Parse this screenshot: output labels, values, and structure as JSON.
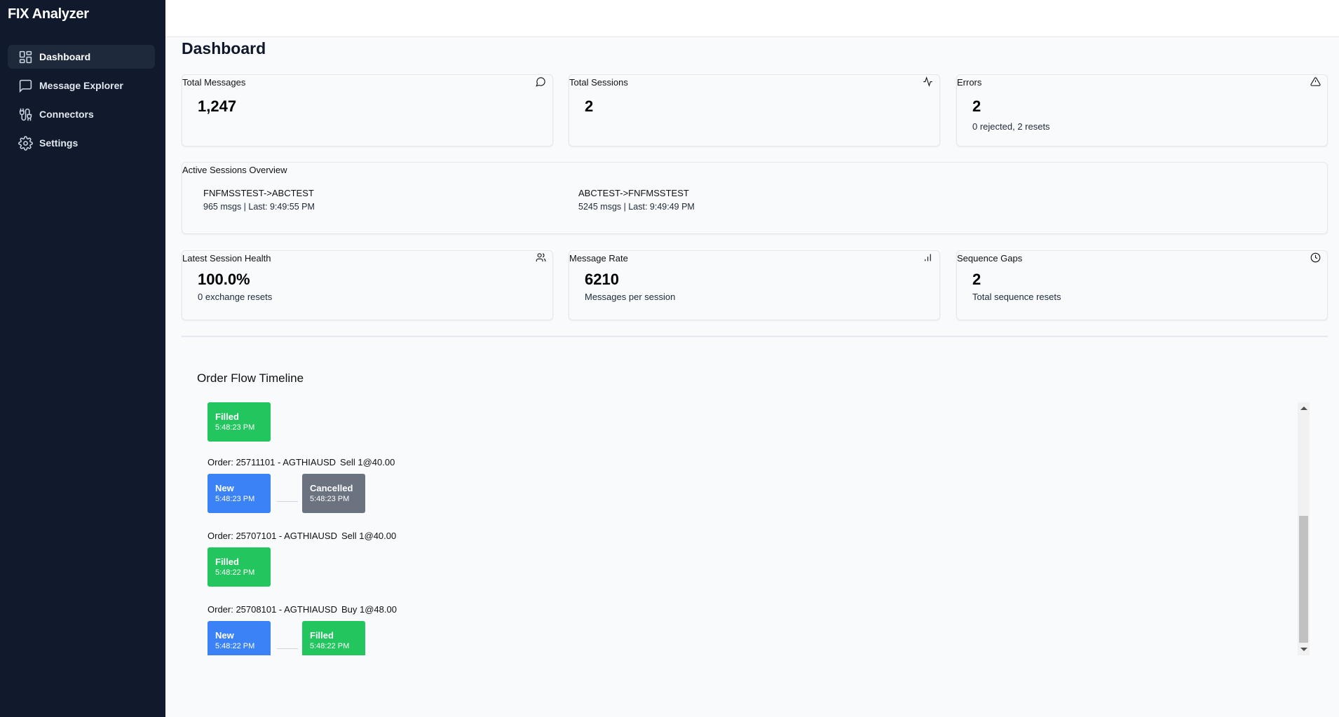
{
  "app": {
    "title": "FIX Analyzer"
  },
  "sidebar": {
    "items": [
      {
        "label": "Dashboard",
        "icon": "dashboard-icon",
        "active": true
      },
      {
        "label": "Message Explorer",
        "icon": "message-square-icon",
        "active": false
      },
      {
        "label": "Connectors",
        "icon": "plug-icon",
        "active": false
      },
      {
        "label": "Settings",
        "icon": "gear-icon",
        "active": false
      }
    ]
  },
  "page": {
    "title": "Dashboard"
  },
  "stats": {
    "total_messages": {
      "title": "Total Messages",
      "value": "1,247",
      "icon": "message-circle-icon"
    },
    "total_sessions": {
      "title": "Total Sessions",
      "value": "2",
      "icon": "activity-icon"
    },
    "errors": {
      "title": "Errors",
      "value": "2",
      "sub": "0 rejected, 2 resets",
      "icon": "alert-triangle-icon"
    },
    "session_health": {
      "title": "Latest Session Health",
      "value": "100.0%",
      "sub": "0 exchange resets",
      "icon": "users-icon"
    },
    "message_rate": {
      "title": "Message Rate",
      "value": "6210",
      "sub": "Messages per session",
      "icon": "bar-chart-icon"
    },
    "sequence_gaps": {
      "title": "Sequence Gaps",
      "value": "2",
      "sub": "Total sequence resets",
      "icon": "clock-icon"
    }
  },
  "sessions": {
    "title": "Active Sessions Overview",
    "items": [
      {
        "name": "FNFMSSTEST->ABCTEST",
        "meta": "965 msgs | Last: 9:49:55 PM"
      },
      {
        "name": "ABCTEST->FNFMSSTEST",
        "meta": "5245 msgs | Last: 9:49:49 PM"
      }
    ]
  },
  "timeline": {
    "title": "Order Flow Timeline",
    "colors": {
      "New": "#3b82f6",
      "Filled": "#22c55e",
      "Cancelled": "#6b7280"
    },
    "partial_top": {
      "events": [
        {
          "status": "Filled",
          "time": "5:48:23 PM"
        }
      ]
    },
    "orders": [
      {
        "label": "Order: 25711101 - AGTHIAUSD",
        "side": "Sell 1@40.00",
        "events": [
          {
            "status": "New",
            "time": "5:48:23 PM"
          },
          {
            "status": "Cancelled",
            "time": "5:48:23 PM"
          }
        ]
      },
      {
        "label": "Order: 25707101 - AGTHIAUSD",
        "side": "Sell 1@40.00",
        "events": [
          {
            "status": "Filled",
            "time": "5:48:22 PM"
          }
        ]
      },
      {
        "label": "Order: 25708101 - AGTHIAUSD",
        "side": "Buy 1@48.00",
        "events": [
          {
            "status": "New",
            "time": "5:48:22 PM"
          },
          {
            "status": "Filled",
            "time": "5:48:22 PM"
          }
        ]
      }
    ],
    "scroll_position": 0.64
  }
}
